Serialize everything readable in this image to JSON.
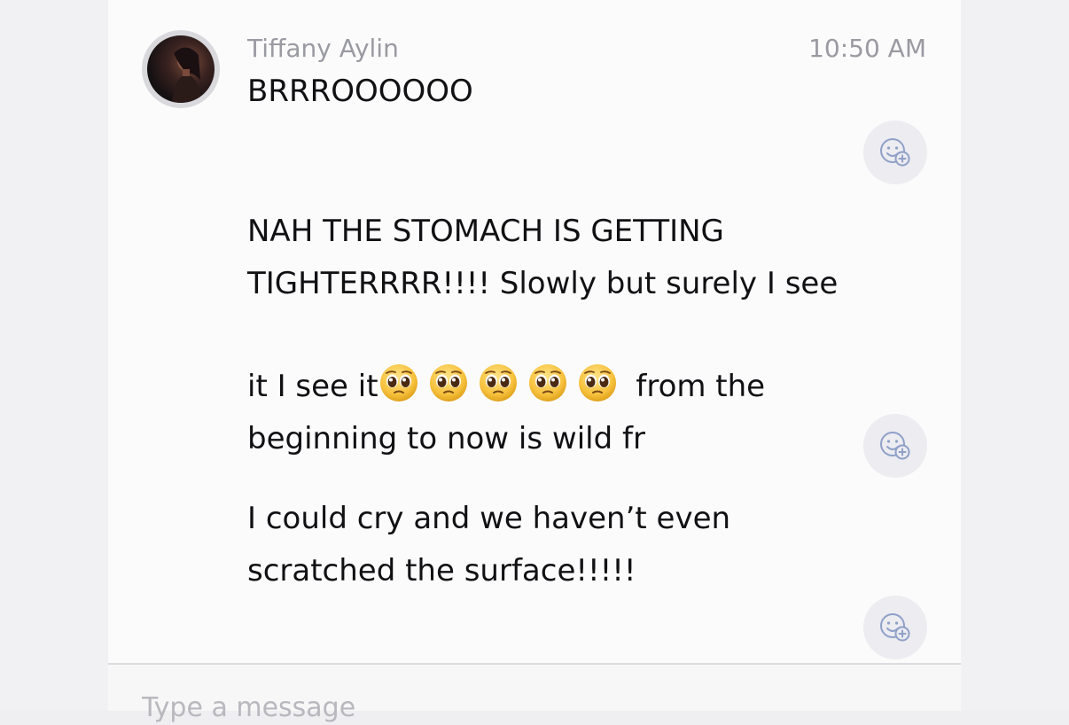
{
  "header": {
    "sender_name": "Tiffany Aylin",
    "timestamp": "10:50 AM"
  },
  "messages": [
    {
      "text": "BRRROOOOOO"
    },
    {
      "text_before_emoji": "NAH THE STOMACH IS GETTING\nTIGHTERRRR!!!! Slowly but surely I see\nit I see it",
      "emoji": [
        "pleading-face",
        "pleading-face",
        "pleading-face",
        "pleading-face",
        "pleading-face"
      ],
      "text_after_emoji": " from the\nbeginning to now is wild fr"
    },
    {
      "text": "I could cry and we haven’t even\nscratched the surface!!!!!"
    }
  ],
  "reaction_button_icon": "add-reaction-icon",
  "composer": {
    "placeholder": "Type a message"
  },
  "colors": {
    "background": "#f1f1f3",
    "panel": "#fbfbfc",
    "secondary_text": "#9a9aa2",
    "message_text": "#111114",
    "reaction_bg": "#ececf1",
    "reaction_icon": "#8fa0c8"
  }
}
